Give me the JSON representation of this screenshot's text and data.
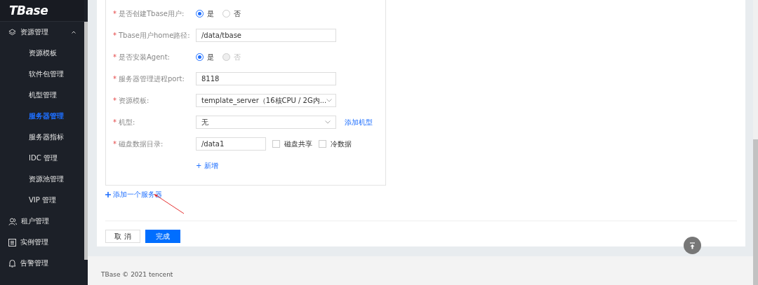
{
  "sidebar": {
    "logo": "TBase",
    "groups": [
      {
        "label": "资源管理",
        "expanded": true,
        "children": [
          {
            "label": "资源模板",
            "selected": false
          },
          {
            "label": "软件包管理",
            "selected": false
          },
          {
            "label": "机型管理",
            "selected": false
          },
          {
            "label": "服务器管理",
            "selected": true
          },
          {
            "label": "服务器指标",
            "selected": false
          },
          {
            "label": "IDC 管理",
            "selected": false
          },
          {
            "label": "资源池管理",
            "selected": false
          },
          {
            "label": "VIP 管理",
            "selected": false
          }
        ]
      },
      {
        "label": "租户管理"
      },
      {
        "label": "实例管理"
      },
      {
        "label": "告警管理"
      }
    ]
  },
  "form": {
    "rows": [
      {
        "kind": "radio",
        "label": "是否创建Tbase用户:",
        "marker": "*",
        "options": [
          {
            "label": "是",
            "selected": true,
            "disabled": false
          },
          {
            "label": "否",
            "selected": false,
            "disabled": false
          }
        ]
      },
      {
        "kind": "input",
        "label": "Tbase用户home路径:",
        "marker": "*",
        "value": "/data/tbase"
      },
      {
        "kind": "radio",
        "label": "是否安装Agent:",
        "marker": "*",
        "options": [
          {
            "label": "是",
            "selected": true,
            "disabled": false
          },
          {
            "label": "否",
            "selected": false,
            "disabled": true
          }
        ]
      },
      {
        "kind": "input",
        "label": "服务器管理进程port:",
        "marker": "*",
        "value": "8118"
      },
      {
        "kind": "select",
        "label": "资源模板:",
        "marker": "*",
        "value": "template_server（16核CPU / 2G内..."
      },
      {
        "kind": "select",
        "label": "机型:",
        "marker": "*",
        "value": "无",
        "link": "添加机型"
      },
      {
        "kind": "disk",
        "label": "磁盘数据目录:",
        "marker": "*",
        "value": "/data1",
        "checks": [
          {
            "label": "磁盘共享",
            "checked": false
          },
          {
            "label": "冷数据",
            "checked": false
          }
        ]
      }
    ],
    "add_link": "+ 新增"
  },
  "add_server": "添加一个服务器",
  "buttons": [
    {
      "label": "取 消",
      "primary": false
    },
    {
      "label": "完成",
      "primary": true
    }
  ],
  "footer": "TBase © 2021 tencent"
}
